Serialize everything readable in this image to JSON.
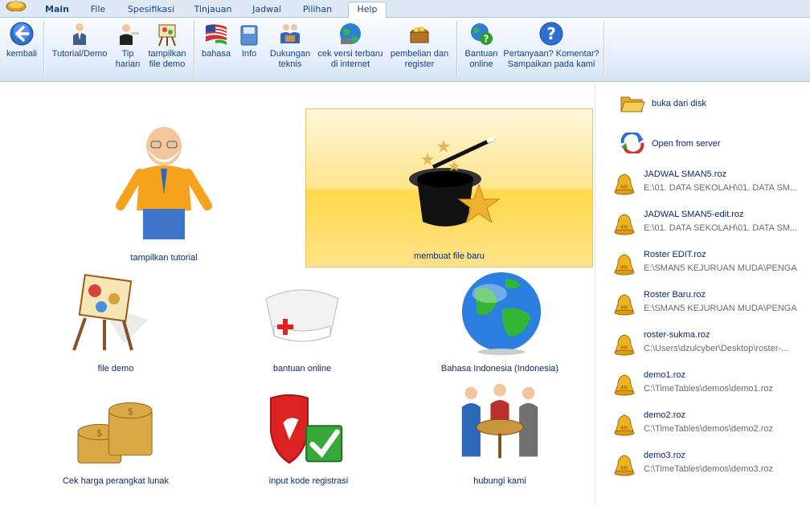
{
  "menu": {
    "tabs": [
      "Main",
      "File",
      "Spesifikasi",
      "Tinjauan",
      "Jadwal",
      "Pilihan",
      "Help"
    ],
    "active_tab": "Help"
  },
  "ribbon": {
    "kembali": "kembali",
    "tutorial": "Tutorial/Demo",
    "tip": "Tip\nharian",
    "tampilkan_demo": "tampilkan\nfile demo",
    "bahasa": "bahasa",
    "info": "Info",
    "dukungan": "Dukungan\nteknis",
    "cek_versi": "cek versi terbaru\ndi internet",
    "pembelian": "pembelian dan\nregister",
    "bantuan_online": "Bantuan\nonline",
    "pertanyaan": "Pertanyaan? Komentar?\nSampaikan pada kami"
  },
  "tiles": {
    "tutorial": "tampilkan tutorial",
    "new_file": "membuat file baru",
    "file_demo": "file demo",
    "bantuan_online": "bantuan online",
    "bahasa": "Bahasa Indonesia (Indonesia)",
    "cek_harga": "Cek harga perangkat lunak",
    "input_kode": "input kode registrasi",
    "hubungi": "hubungi kami"
  },
  "recent": {
    "open_disk": "buka dari disk",
    "open_server": "Open from server",
    "files": [
      {
        "name": "JADWAL SMAN5.roz",
        "path": "E:\\01. DATA SEKOLAH\\01. DATA SM..."
      },
      {
        "name": "JADWAL SMAN5-edit.roz",
        "path": "E:\\01. DATA SEKOLAH\\01. DATA SM..."
      },
      {
        "name": "Roster EDIT.roz",
        "path": "E:\\SMAN5 KEJURUAN MUDA\\PENGA..."
      },
      {
        "name": "Roster Baru.roz",
        "path": "E:\\SMAN5 KEJURUAN MUDA\\PENGA..."
      },
      {
        "name": "roster-sukma.roz",
        "path": "C:\\Users\\dzulcyber\\Desktop\\roster-..."
      },
      {
        "name": "demo1.roz",
        "path": "C:\\TimeTables\\demos\\demo1.roz"
      },
      {
        "name": "demo2.roz",
        "path": "C:\\TimeTables\\demos\\demo2.roz"
      },
      {
        "name": "demo3.roz",
        "path": "C:\\TimeTables\\demos\\demo3.roz"
      }
    ],
    "bell_label": "asc"
  },
  "colors": {
    "accent": "#15428b",
    "tile_highlight": "#ffd84a",
    "path_gray": "#6b6b6b"
  }
}
